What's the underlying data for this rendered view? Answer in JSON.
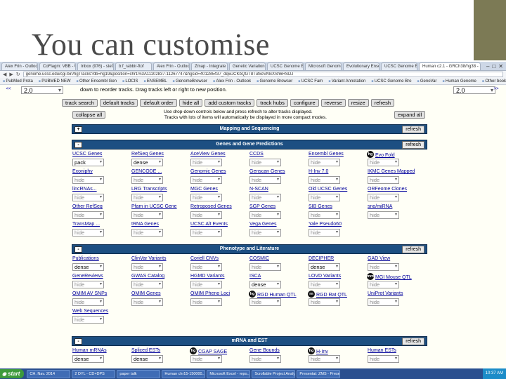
{
  "slide": {
    "title": "You can customise"
  },
  "browser": {
    "tabs": [
      "Alex Frin - Outlook Web App",
      "CoFlagm: VBB - Ubuntum Sm",
      "Inbox (976) - stefan.brangal",
      "b:f_rabbir-ftof",
      "Alex Frin - Outlook Web App",
      "Zmap - Integrate Dan P...",
      "Genetic Variation MPI -",
      "UCSC Genome Browser",
      "Microsoft Genome Bro...",
      "Evolutionary Ensembl -",
      "UCSC Genome Bro...",
      "Human c2.1 - GRCh38/hg38 - ..."
    ],
    "active_tab": 11,
    "url": "genome.ucsc.edu/cgi-bin/hgTracks?db=hg19&position=chr1%3A11102837-11267747&hgsid=401285437_dqwJCKbQGT8TufxeVMxXSh6HSDJ",
    "bookmarks": [
      "PubMed Prota",
      "PUBMED NEW",
      "Other Ensembl Gen",
      "LOCIS",
      "ENSEMBL",
      "GenomeBrowser",
      "Alex Frin - Outlook",
      "Genome Browser",
      "UCSC Fam",
      "Variant Annotation",
      "UCSC Genome Bro",
      "GenoVar",
      "Human Genome"
    ],
    "bookmarks_other": "Other bookmarks"
  },
  "controls": {
    "arrow_left": "<<",
    "arrow_right": ">>",
    "zoom_left": "2.0",
    "zoom_right": "2.0",
    "instruction": "down to reorder tracks. Drag tracks left or right to new position.",
    "buttons": [
      "track search",
      "default tracks",
      "default order",
      "hide all",
      "add custom tracks",
      "track hubs",
      "configure",
      "reverse",
      "resize",
      "refresh"
    ],
    "collapse_all": "collapse all",
    "expand_all": "expand all",
    "hint_line1": "Use drop-down controls below and press refresh to alter tracks displayed.",
    "hint_line2": "Tracks with lots of items will automatically be displayed in more compact modes."
  },
  "sections": [
    {
      "toggle": "+",
      "title": "Mapping and Sequencing",
      "refresh": "refresh"
    },
    {
      "toggle": "-",
      "title": "Genes and Gene Predictions",
      "refresh": "refresh",
      "tracks": [
        {
          "name": "UCSC Genes",
          "mode": "pack"
        },
        {
          "name": "RefSeq Genes",
          "mode": "dense"
        },
        {
          "name": "AceView Genes",
          "mode": "hide"
        },
        {
          "name": "CCDS",
          "mode": "hide"
        },
        {
          "name": "Ensembl Genes",
          "mode": "hide"
        },
        {
          "name": "Evo Fold",
          "mode": "hide",
          "badge": "hg"
        },
        {
          "name": "Exoniphy",
          "mode": "hide"
        },
        {
          "name": "GENCODE ...",
          "mode": "hide"
        },
        {
          "name": "Genomic Genes",
          "mode": "hide"
        },
        {
          "name": "Genscan Genes",
          "mode": "hide"
        },
        {
          "name": "H-Inv 7.0",
          "mode": "hide"
        },
        {
          "name": "IKMC Genes Mapped",
          "mode": "hide"
        },
        {
          "name": "lincRNAs...",
          "mode": "hide"
        },
        {
          "name": "LRG Transcripts",
          "mode": "hide"
        },
        {
          "name": "MGC Genes",
          "mode": "hide"
        },
        {
          "name": "N-SCAN",
          "mode": "hide"
        },
        {
          "name": "Old UCSC Genes",
          "mode": "hide"
        },
        {
          "name": "ORFeome Clones",
          "mode": "hide"
        },
        {
          "name": "Other RefSeq",
          "mode": "hide"
        },
        {
          "name": "Pfam in UCSC Gene",
          "mode": "hide"
        },
        {
          "name": "Retroposed Genes",
          "mode": "hide"
        },
        {
          "name": "SGP Genes",
          "mode": "hide"
        },
        {
          "name": "SIB Genes",
          "mode": "hide"
        },
        {
          "name": "sno/miRNA",
          "mode": "hide"
        },
        {
          "name": "TransMap ...",
          "mode": "hide"
        },
        {
          "name": "tRNA Genes",
          "mode": "hide"
        },
        {
          "name": "UCSC Alt Events",
          "mode": "hide"
        },
        {
          "name": "Vega Genes",
          "mode": "hide"
        },
        {
          "name": "Yale Pseudo60",
          "mode": "hide"
        }
      ]
    },
    {
      "toggle": "-",
      "title": "Phenotype and Literature",
      "refresh": "refresh",
      "tracks": [
        {
          "name": "Publications",
          "mode": "dense"
        },
        {
          "name": "ClinVar Variants",
          "mode": "hide"
        },
        {
          "name": "Coriell CNVs",
          "mode": "hide"
        },
        {
          "name": "COSMIC",
          "mode": "hide"
        },
        {
          "name": "DECIPHER",
          "mode": "dense"
        },
        {
          "name": "GAD View",
          "mode": "hide"
        },
        {
          "name": "GeneReviews",
          "mode": "hide"
        },
        {
          "name": "GWAS Catalog",
          "mode": "hide"
        },
        {
          "name": "HGMD Variants",
          "mode": "hide"
        },
        {
          "name": "ISCA",
          "mode": "dense"
        },
        {
          "name": "LOVD Variants",
          "mode": "hide"
        },
        {
          "name": "MGI Mouse QTL",
          "mode": "hide",
          "badge": "mm"
        },
        {
          "name": "OMIM AV SNPs",
          "mode": "hide"
        },
        {
          "name": "OMIM Genes",
          "mode": "hide"
        },
        {
          "name": "OMIM Pheno Loci",
          "mode": "hide"
        },
        {
          "name": "RGD Human QTL",
          "mode": "hide",
          "badge": "hg"
        },
        {
          "name": "RGD Rat QTL",
          "mode": "hide",
          "badge": "rn"
        },
        {
          "name": "UniProt Variants",
          "mode": "hide"
        },
        {
          "name": "Web Sequences",
          "mode": "hide"
        }
      ]
    },
    {
      "toggle": "-",
      "title": "mRNA and EST",
      "refresh": "refresh",
      "tracks": [
        {
          "name": "Human mRNAs",
          "mode": "dense"
        },
        {
          "name": "Spliced ESTs",
          "mode": "dense"
        },
        {
          "name": "CGAP SAGE",
          "mode": "hide",
          "badge": "hg"
        },
        {
          "name": "Gene Bounds",
          "mode": "hide"
        },
        {
          "name": "H-Inv",
          "mode": "hide",
          "badge": "hg"
        },
        {
          "name": "Human ESTs",
          "mode": "hide"
        }
      ]
    }
  ],
  "taskbar": {
    "start": "start",
    "tasks": [
      "CH. Nav. 2014",
      "2 DYL - CD+DPS",
      "paper talk",
      "Human chr15-150000...",
      "Microsoft Excel - repo...",
      "Scrollable Project Analy...",
      "Presentat: ZMS - Presen..."
    ],
    "clock": "10:37 AM"
  },
  "colors": {
    "section_bar": "#1d4f82",
    "link": "#00009c",
    "page_bg": "#fffff6",
    "deco": "#7c7a55"
  }
}
